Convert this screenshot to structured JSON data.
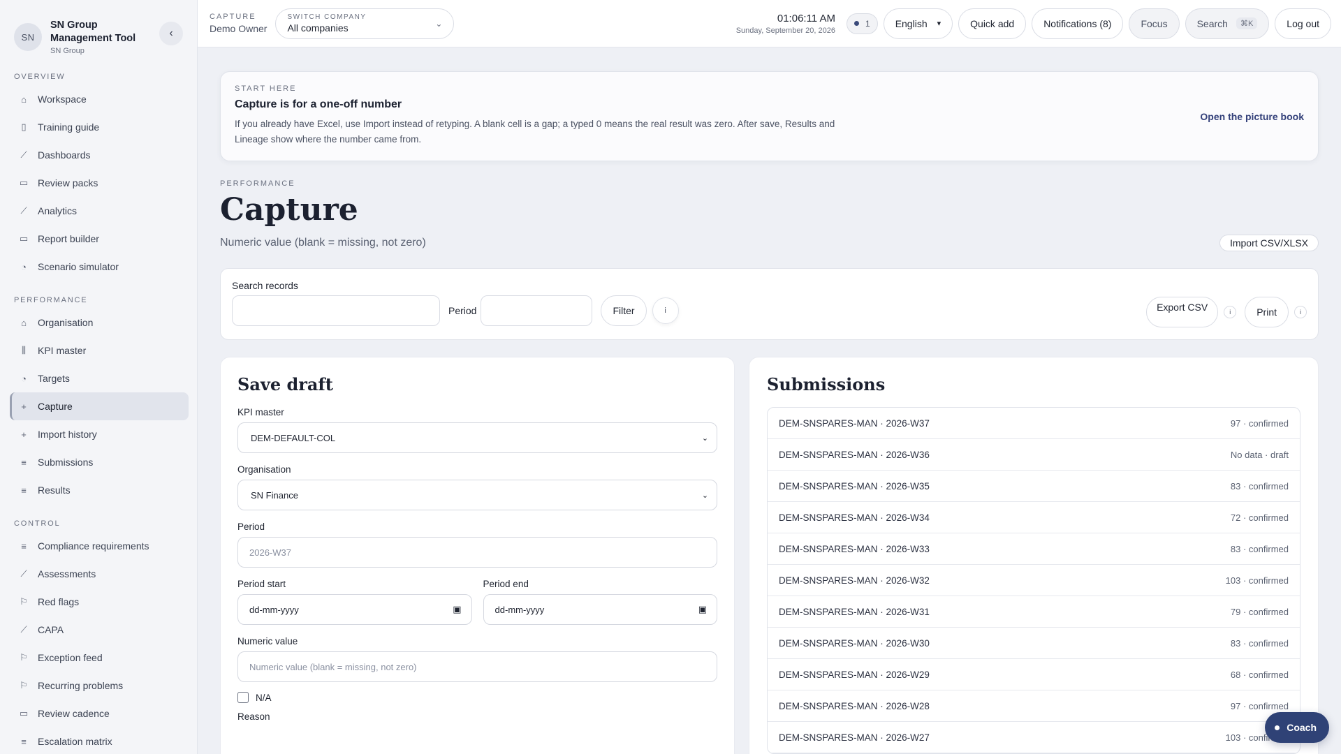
{
  "brand": {
    "initials": "SN",
    "title": "SN Group Management Tool",
    "subtitle": "SN Group",
    "collapse_icon": "chevron-left-icon"
  },
  "sidebar": {
    "sections": [
      {
        "heading": "OVERVIEW",
        "items": [
          {
            "label": "Workspace",
            "icon": "⌂"
          },
          {
            "label": "Training guide",
            "icon": "▯"
          },
          {
            "label": "Dashboards",
            "icon": "⟋"
          },
          {
            "label": "Review packs",
            "icon": "▭"
          },
          {
            "label": "Analytics",
            "icon": "⟋"
          },
          {
            "label": "Report builder",
            "icon": "▭"
          },
          {
            "label": "Scenario simulator",
            "icon": "◔"
          }
        ]
      },
      {
        "heading": "PERFORMANCE",
        "items": [
          {
            "label": "Organisation",
            "icon": "⌂"
          },
          {
            "label": "KPI master",
            "icon": "⫼"
          },
          {
            "label": "Targets",
            "icon": "◔"
          },
          {
            "label": "Capture",
            "icon": "+",
            "active": true
          },
          {
            "label": "Import history",
            "icon": "+"
          },
          {
            "label": "Submissions",
            "icon": "≡"
          },
          {
            "label": "Results",
            "icon": "≡"
          }
        ]
      },
      {
        "heading": "CONTROL",
        "items": [
          {
            "label": "Compliance requirements",
            "icon": "≡"
          },
          {
            "label": "Assessments",
            "icon": "⟋"
          },
          {
            "label": "Red flags",
            "icon": "⚐"
          },
          {
            "label": "CAPA",
            "icon": "⟋"
          },
          {
            "label": "Exception feed",
            "icon": "⚐"
          },
          {
            "label": "Recurring problems",
            "icon": "⚐"
          },
          {
            "label": "Review cadence",
            "icon": "▭"
          },
          {
            "label": "Escalation matrix",
            "icon": "≡"
          }
        ]
      }
    ]
  },
  "topbar": {
    "context_label": "CAPTURE",
    "context_value": "Demo Owner",
    "switch_label": "SWITCH COMPANY",
    "switch_value": "All companies",
    "time": "01:06:11 AM",
    "date": "Sunday, September 20, 2026",
    "presence_count": "1",
    "language": "English",
    "quick_add": "Quick add",
    "notifications": "Notifications (8)",
    "focus": "Focus",
    "search": "Search",
    "search_shortcut": "⌘K",
    "logout": "Log out"
  },
  "start_here": {
    "kicker": "START HERE",
    "title": "Capture is for a one-off number",
    "body": "If you already have Excel, use Import instead of retyping. A blank cell is a gap; a typed 0 means the real result was zero. After save, Results and Lineage show where the number came from.",
    "link": "Open the picture book"
  },
  "page": {
    "kicker": "PERFORMANCE",
    "title": "Capture",
    "subtitle": "Numeric value (blank = missing, not zero)",
    "import_button": "Import CSV/XLSX"
  },
  "search": {
    "label": "Search records",
    "query": "",
    "period_label": "Period",
    "period_value": "",
    "filter_button": "Filter",
    "info": "i",
    "export_button": "Export CSV",
    "print_button": "Print"
  },
  "form": {
    "title": "Save draft",
    "kpi_label": "KPI master",
    "kpi_value": "DEM-DEFAULT-COL",
    "org_label": "Organisation",
    "org_value": "SN Finance",
    "period_label": "Period",
    "period_placeholder": "2026-W37",
    "period_start_label": "Period start",
    "period_start_placeholder": "dd-mm-yyyy",
    "period_end_label": "Period end",
    "period_end_placeholder": "dd-mm-yyyy",
    "numeric_label": "Numeric value",
    "numeric_placeholder": "Numeric value (blank = missing, not zero)",
    "na_label": "N/A",
    "reason_label": "Reason"
  },
  "submissions": {
    "title": "Submissions",
    "rows": [
      {
        "name": "DEM-SNSPARES-MAN · 2026-W37",
        "status": "97 · confirmed"
      },
      {
        "name": "DEM-SNSPARES-MAN · 2026-W36",
        "status": "No data · draft"
      },
      {
        "name": "DEM-SNSPARES-MAN · 2026-W35",
        "status": "83 · confirmed"
      },
      {
        "name": "DEM-SNSPARES-MAN · 2026-W34",
        "status": "72 · confirmed"
      },
      {
        "name": "DEM-SNSPARES-MAN · 2026-W33",
        "status": "83 · confirmed"
      },
      {
        "name": "DEM-SNSPARES-MAN · 2026-W32",
        "status": "103 · confirmed"
      },
      {
        "name": "DEM-SNSPARES-MAN · 2026-W31",
        "status": "79 · confirmed"
      },
      {
        "name": "DEM-SNSPARES-MAN · 2026-W30",
        "status": "83 · confirmed"
      },
      {
        "name": "DEM-SNSPARES-MAN · 2026-W29",
        "status": "68 · confirmed"
      },
      {
        "name": "DEM-SNSPARES-MAN · 2026-W28",
        "status": "97 · confirmed"
      },
      {
        "name": "DEM-SNSPARES-MAN · 2026-W27",
        "status": "103 · confirmed"
      }
    ]
  },
  "coach": {
    "label": "Coach"
  },
  "colors": {
    "accent": "#2f4276",
    "active_nav": "#e1e4ec"
  }
}
